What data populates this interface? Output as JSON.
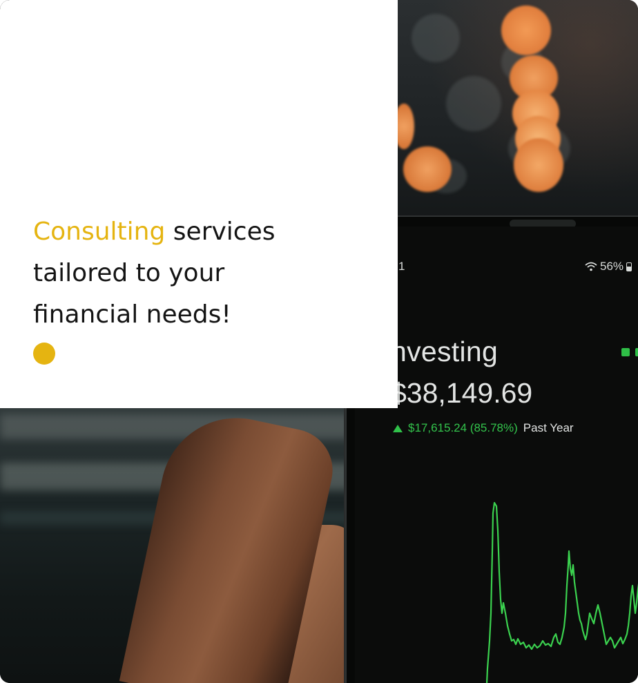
{
  "hero": {
    "headline_accent": "Consulting",
    "headline_rest_line1": " services",
    "headline_line2": "tailored to your",
    "headline_line3": "financial needs!",
    "accent_color": "#e5b411"
  },
  "phone": {
    "status_time": "1",
    "status_battery": "56%",
    "title": "nvesting",
    "value": "$38,149.69",
    "change_amount": "$17,615.24 (85.78%)",
    "change_period": "Past Year",
    "chart_color": "#3bd24f"
  }
}
